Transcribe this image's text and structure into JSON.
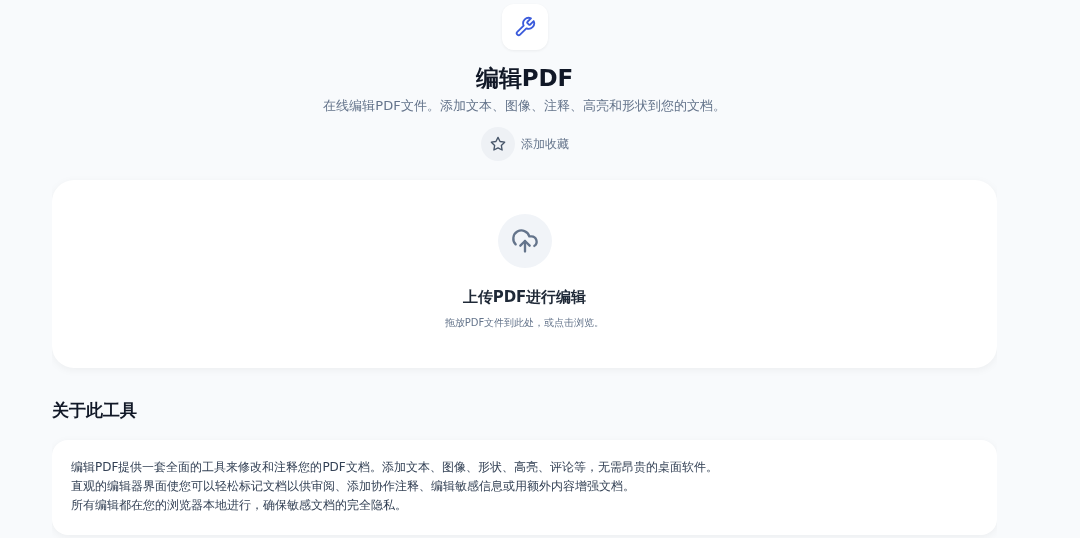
{
  "header": {
    "title": "编辑PDF",
    "subtitle": "在线编辑PDF文件。添加文本、图像、注释、高亮和形状到您的文档。",
    "favorite_label": "添加收藏"
  },
  "upload": {
    "heading": "上传PDF进行编辑",
    "hint": "拖放PDF文件到此处，或点击浏览。"
  },
  "about": {
    "heading": "关于此工具",
    "paragraphs": [
      "编辑PDF提供一套全面的工具来修改和注释您的PDF文档。添加文本、图像、形状、高亮、评论等，无需昂贵的桌面软件。",
      "直观的编辑器界面使您可以轻松标记文档以供审阅、添加协作注释、编辑敏感信息或用额外内容增强文档。",
      "所有编辑都在您的浏览器本地进行，确保敏感文档的完全隐私。"
    ]
  }
}
